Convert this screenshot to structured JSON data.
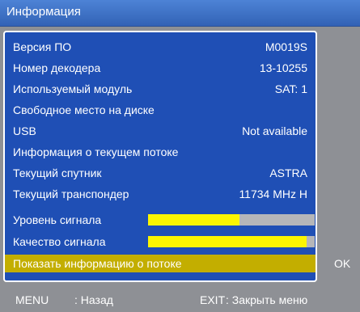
{
  "title": "Информация",
  "rows": [
    {
      "label": "Версия ПО",
      "value": "M0019S"
    },
    {
      "label": "Номер декодера",
      "value": "13-10255"
    },
    {
      "label": "Используемый модуль",
      "value": "SAT: 1"
    },
    {
      "label": "Свободное место на диске",
      "value": ""
    },
    {
      "label": "USB",
      "value": "Not available"
    },
    {
      "label": "Информация о текущем потоке",
      "value": ""
    },
    {
      "label": "Текущий спутник",
      "value": "ASTRA"
    },
    {
      "label": "Текущий транспондер",
      "value": "11734 MHz  H"
    }
  ],
  "signal_level": {
    "label": "Уровень сигнала",
    "fraction": 0.55
  },
  "signal_quality": {
    "label": "Качество сигнала",
    "fraction": 0.95
  },
  "action": {
    "label": "Показать информацию о потоке",
    "ok_label": "OK"
  },
  "footer": {
    "menu_key": "MENU",
    "menu_action": ": Назад",
    "exit_key": "EXIT",
    "exit_action": ": Закрыть меню"
  },
  "colors": {
    "panel": "#1f4fb5",
    "highlight": "#c3ae00",
    "bar_fill": "#fbf500",
    "bar_track": "#b5b6b9",
    "background": "#8e9095"
  }
}
